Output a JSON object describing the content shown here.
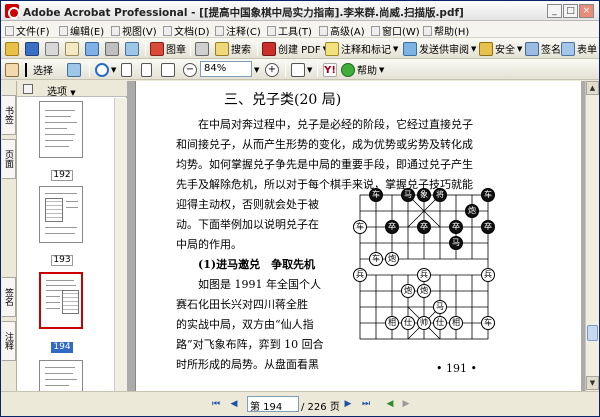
{
  "window": {
    "title": "Adobe Acrobat Professional - [[提高中国象棋中局实力指南].李来群.尚威.扫描版.pdf]",
    "controls": [
      "_",
      "□",
      "×"
    ]
  },
  "menu": [
    "文件(F)",
    "编辑(E)",
    "视图(V)",
    "文档(D)",
    "注释(C)",
    "工具(T)",
    "高级(A)",
    "窗口(W)",
    "帮助(H)"
  ],
  "toolbar1": {
    "image_label": "图章",
    "search_label": "搜索",
    "create_pdf_label": "创建 PDF",
    "comment_label": "注释和标记",
    "review_label": "发送供审阅",
    "secure_label": "安全",
    "sign_label": "签名",
    "forms_label": "表单"
  },
  "toolbar2": {
    "select_label": "选择",
    "zoom_value": "84%",
    "help_label": "帮助"
  },
  "nav_tabs": [
    "书签",
    "页面",
    "签名",
    "注释"
  ],
  "thumb_panel": {
    "options_label": "选项",
    "labels": [
      "192",
      "193",
      "194"
    ],
    "selected": "194"
  },
  "page_content": {
    "heading": "三、兑子类(20 局)",
    "para1": [
      "在中局对奔过程中，兑子是必经的阶段，它经过直接兑子",
      "和间接兑子，从而产生形势的变化，成为优势或劣势及转化成",
      "均势。如何掌握兑子争先是中局的重要手段，即通过兑子产生",
      "先手及解除危机，所以对于每个棋手来说，掌握兑子技巧就能"
    ],
    "para2": [
      "迎得主动权，否则就会处于被",
      "动。下面举例加以说明兑子在",
      "中局的作用。"
    ],
    "subheading": "(1)进马邀兑　争取先机",
    "para3": [
      "如图是 1991 年全国个人",
      "赛石化田长兴对四川蒋全胜",
      "的实战中局，双方由“仙人指",
      "路”对飞象布阵，弈到 10 回合",
      "时所形成的局势。从盘面看黑"
    ],
    "page_number": "• 191 •"
  },
  "board": {
    "black_pieces": [
      "车",
      "马",
      "象",
      "将",
      "车",
      "炮",
      "卒",
      "卒",
      "卒",
      "卒",
      "马"
    ],
    "red_pieces": [
      "车",
      "车",
      "炮",
      "兵",
      "兵",
      "兵",
      "炮",
      "炮",
      "马",
      "相",
      "仕",
      "帅",
      "仕",
      "相",
      "车"
    ]
  },
  "statusbar": {
    "page_field": "第 194",
    "page_total": "/ 226 页"
  }
}
